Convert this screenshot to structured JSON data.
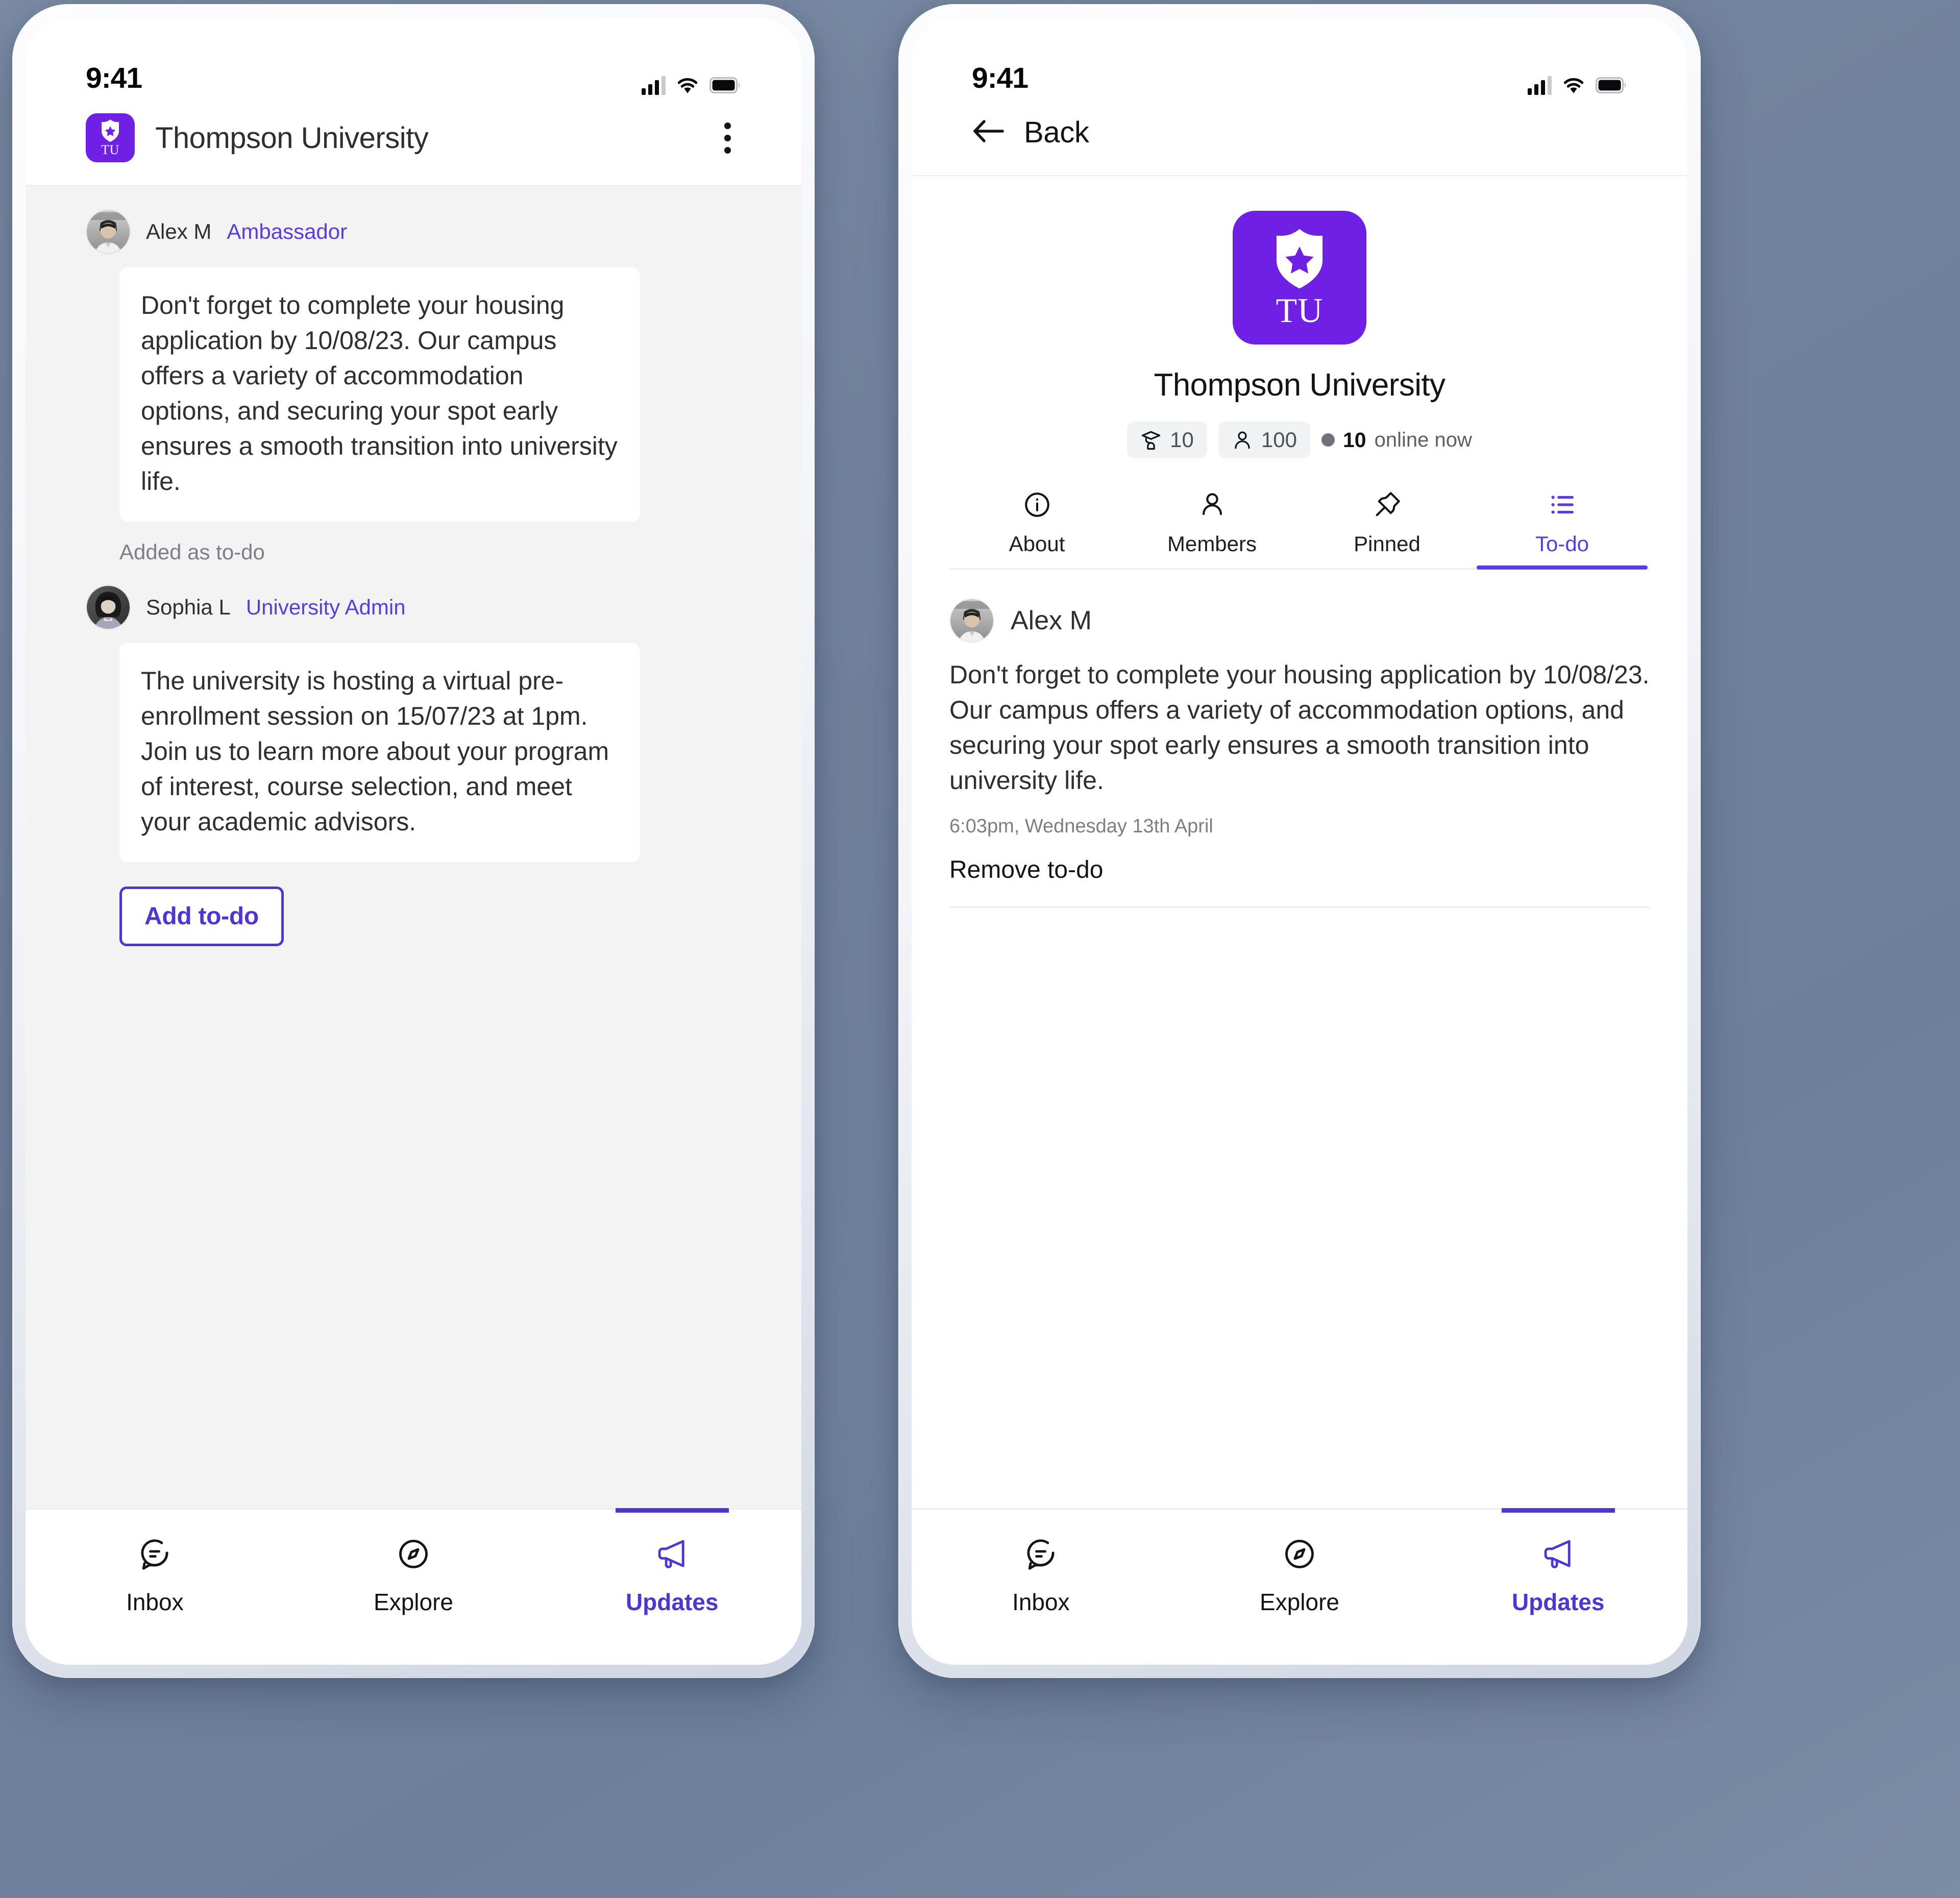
{
  "background": {
    "color": "#71829c"
  },
  "theme": {
    "accent": "#4f35d4",
    "accent_text": "#5b3ce0",
    "logo_purple": "#7020e5",
    "chat_bg": "#f2f3f2",
    "body_text": "#2d2f33"
  },
  "status_bar": {
    "time": "9:41"
  },
  "screen_left": {
    "topbar": {
      "title": "Thompson University",
      "logo_initials": "TU",
      "menu_icon": "kebab-menu-icon"
    },
    "messages": [
      {
        "name": "Alex M",
        "role": "Ambassador",
        "text": "Don't forget to complete your housing application by 10/08/23. Our campus offers a variety of accommodation options, and securing your spot early ensures a smooth transition into university life.",
        "note": "Added as to-do"
      },
      {
        "name": "Sophia L",
        "role": "University Admin",
        "text": "The university is hosting a virtual pre-enrollment session on 15/07/23 at 1pm. Join us to learn more about your program of interest, course selection, and meet your academic advisors.",
        "action_label": "Add to-do"
      }
    ],
    "bottom_nav": {
      "items": [
        {
          "label": "Inbox",
          "icon": "chat-bubble-icon",
          "active": false
        },
        {
          "label": "Explore",
          "icon": "compass-icon",
          "active": false
        },
        {
          "label": "Updates",
          "icon": "megaphone-icon",
          "active": true
        }
      ]
    }
  },
  "screen_right": {
    "topbar": {
      "back_label": "Back",
      "back_icon": "arrow-left-icon"
    },
    "profile": {
      "logo_initials": "TU",
      "name": "Thompson University",
      "stats": [
        {
          "icon": "graduation-cap-icon",
          "value": "10"
        },
        {
          "icon": "person-icon",
          "value": "100"
        }
      ],
      "online": {
        "count": "10",
        "suffix": "online now"
      }
    },
    "tabs": [
      {
        "label": "About",
        "icon": "info-circle-icon",
        "active": false
      },
      {
        "label": "Members",
        "icon": "person-icon",
        "active": false
      },
      {
        "label": "Pinned",
        "icon": "pin-icon",
        "active": false
      },
      {
        "label": "To-do",
        "icon": "list-icon",
        "active": true
      }
    ],
    "todo": {
      "name": "Alex M",
      "text": "Don't forget to complete your housing application by 10/08/23. Our campus offers a variety of accommodation options, and securing your spot early ensures a smooth transition into university life.",
      "timestamp": "6:03pm, Wednesday 13th April",
      "remove_label": "Remove to-do"
    },
    "bottom_nav": {
      "items": [
        {
          "label": "Inbox",
          "icon": "chat-bubble-icon",
          "active": false
        },
        {
          "label": "Explore",
          "icon": "compass-icon",
          "active": false
        },
        {
          "label": "Updates",
          "icon": "megaphone-icon",
          "active": true
        }
      ]
    }
  }
}
